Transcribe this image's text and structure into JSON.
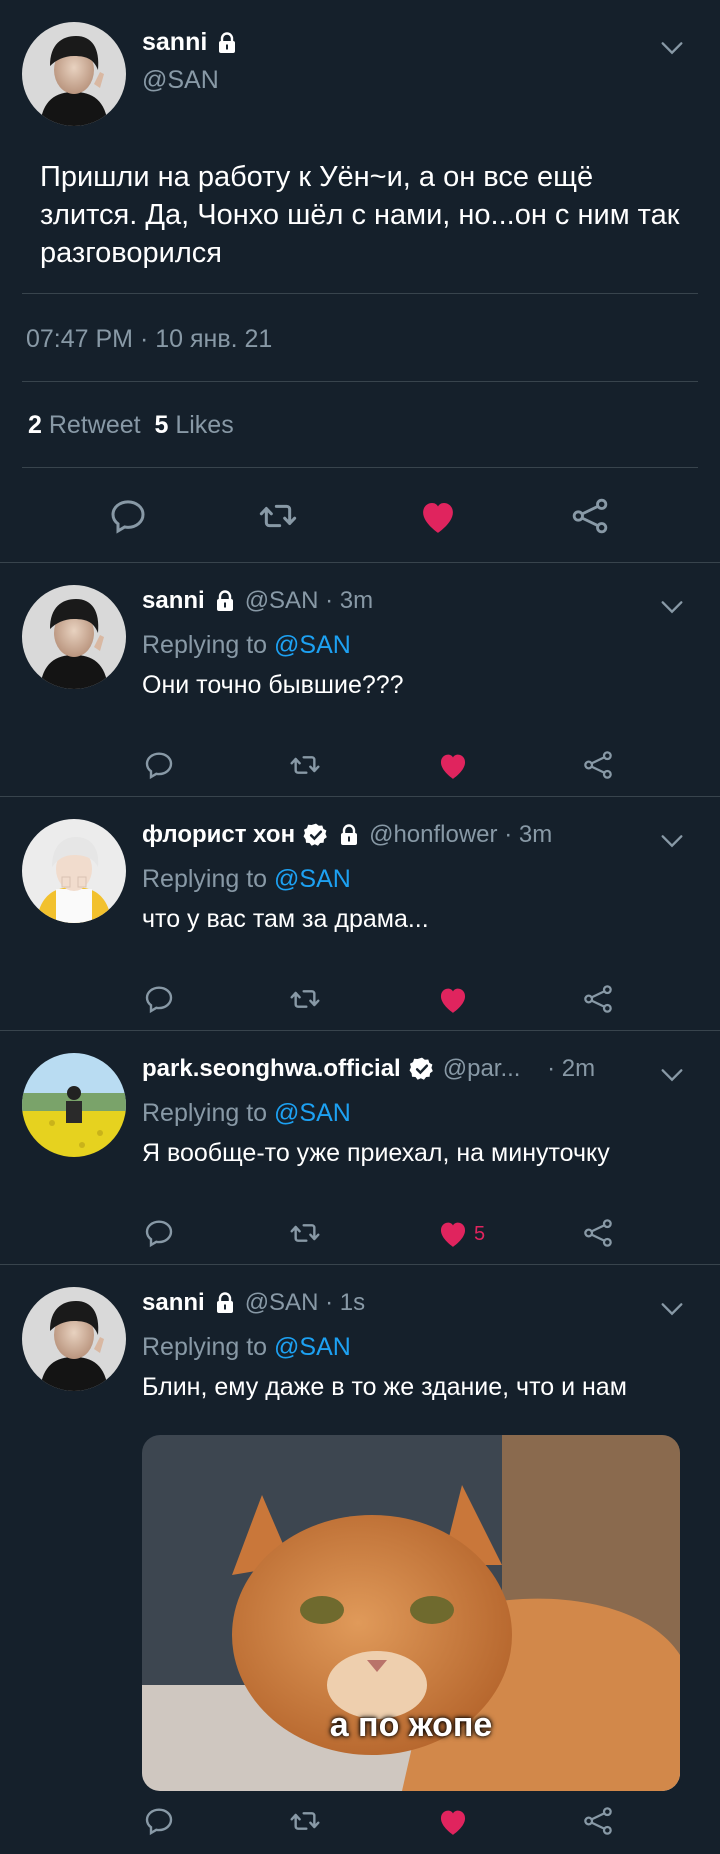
{
  "main_tweet": {
    "name": "sanni",
    "handle": "@SAN",
    "text": "Пришли на работу к Уён~и, а он все ещё злится. Да, Чонхо шёл с нами, но...он с ним так разговорился",
    "timestamp": "07:47 PM · 10 янв. 21",
    "retweets_count": "2",
    "retweets_label": "Retweet",
    "likes_count": "5",
    "likes_label": "Likes"
  },
  "replies": [
    {
      "name": "sanni",
      "handle": "@SAN",
      "time": "· 3m",
      "replying_label": "Replying to",
      "replying_handle": "@SAN",
      "text": "Они точно бывшие???",
      "like_count": ""
    },
    {
      "name": "флорист хон",
      "handle": "@honflower",
      "time": "· 3m",
      "replying_label": "Replying to",
      "replying_handle": "@SAN",
      "text": "что у вас там за драма...",
      "like_count": ""
    },
    {
      "name": "park.seonghwa.official",
      "handle": "@par...",
      "time": "· 2m",
      "replying_label": "Replying to",
      "replying_handle": "@SAN",
      "text": "Я вообще-то уже приехал, на минуточку",
      "like_count": "5"
    },
    {
      "name": "sanni",
      "handle": "@SAN",
      "time": "· 1s",
      "replying_label": "Replying to",
      "replying_handle": "@SAN",
      "text": "Блин, ему даже в то же здание, что и нам",
      "image_caption": "а по жопе",
      "like_count": ""
    }
  ],
  "colors": {
    "background": "#15202b",
    "muted": "#8899a6",
    "link": "#1da1f2",
    "like": "#e0245e",
    "verified": "#ffffff",
    "divider": "#38444d"
  },
  "icons": [
    "lock-icon",
    "verified-icon",
    "chevron-down-icon",
    "reply-icon",
    "retweet-icon",
    "heart-icon",
    "share-icon"
  ]
}
